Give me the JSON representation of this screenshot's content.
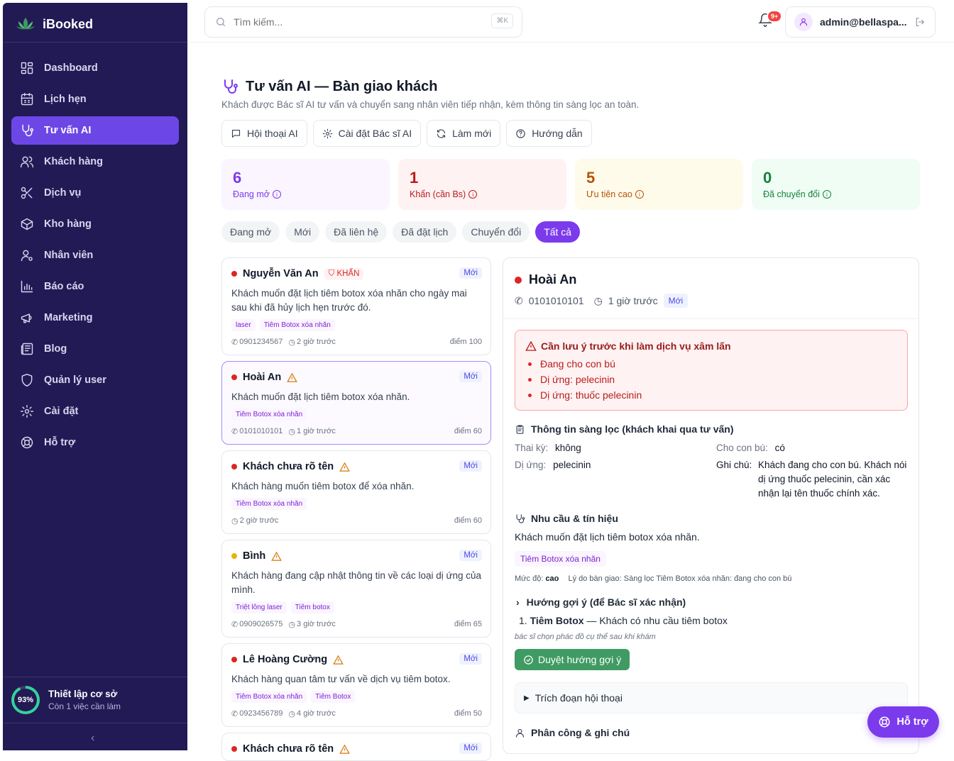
{
  "brand": {
    "name": "iBooked"
  },
  "nav": [
    {
      "label": "Dashboard",
      "icon": "grid-icon"
    },
    {
      "label": "Lịch hẹn",
      "icon": "calendar-icon"
    },
    {
      "label": "Tư vấn AI",
      "icon": "stethoscope-icon"
    },
    {
      "label": "Khách hàng",
      "icon": "users-icon"
    },
    {
      "label": "Dịch vụ",
      "icon": "scissors-icon"
    },
    {
      "label": "Kho hàng",
      "icon": "box-icon"
    },
    {
      "label": "Nhân viên",
      "icon": "user-gear-icon"
    },
    {
      "label": "Báo cáo",
      "icon": "bar-chart-icon"
    },
    {
      "label": "Marketing",
      "icon": "megaphone-icon"
    },
    {
      "label": "Blog",
      "icon": "newspaper-icon"
    },
    {
      "label": "Quản lý user",
      "icon": "shield-icon"
    },
    {
      "label": "Cài đặt",
      "icon": "gear-icon"
    },
    {
      "label": "Hỗ trợ",
      "icon": "lifebuoy-icon"
    }
  ],
  "setup": {
    "percent": "93%",
    "percent_value": 93,
    "title": "Thiết lập cơ sở",
    "subtitle": "Còn 1 việc cần làm"
  },
  "topbar": {
    "search_placeholder": "Tìm kiếm...",
    "shortcut": "⌘K",
    "notifications": "9+",
    "user_email": "admin@bellaspa..."
  },
  "page": {
    "title": "Tư vấn AI — Bàn giao khách",
    "subtitle": "Khách được Bác sĩ AI tư vấn và chuyển sang nhân viên tiếp nhận, kèm thông tin sàng lọc an toàn.",
    "actions": [
      "Hội thoại AI",
      "Cài đặt Bác sĩ AI",
      "Làm mới",
      "Hướng dẫn"
    ]
  },
  "stats": [
    {
      "value": "6",
      "label": "Đang mở",
      "color": "#7c3aed",
      "bg": "#faf5ff"
    },
    {
      "value": "1",
      "label": "Khẩn (cần Bs)",
      "color": "#b91c1c",
      "bg": "#fef2f2"
    },
    {
      "value": "5",
      "label": "Ưu tiên cao",
      "color": "#b45309",
      "bg": "#fffbeb"
    },
    {
      "value": "0",
      "label": "Đã chuyển đổi",
      "color": "#15803d",
      "bg": "#f0fdf4"
    }
  ],
  "filters": [
    "Đang mở",
    "Mới",
    "Đã liên hệ",
    "Đã đặt lịch",
    "Chuyển đổi",
    "Tất cả"
  ],
  "cards": [
    {
      "name": "Nguyễn Văn An",
      "urgent": "KHẨN",
      "status": "Mới",
      "desc": "Khách muốn đặt lịch tiêm botox xóa nhăn cho ngày mai sau khi đã hủy lịch hẹn trước đó.",
      "tags": [
        "laser",
        "Tiêm Botox xóa nhăn"
      ],
      "phone": "0901234567",
      "time": "2 giờ trước",
      "score": "điểm 100"
    },
    {
      "name": "Hoài An",
      "status": "Mới",
      "desc": "Khách muốn đặt lịch tiêm botox xóa nhăn.",
      "tags": [
        "Tiêm Botox xóa nhăn"
      ],
      "phone": "0101010101",
      "time": "1 giờ trước",
      "score": "điểm 60"
    },
    {
      "name": "Khách chưa rõ tên",
      "status": "Mới",
      "desc": "Khách hàng muốn tiêm botox để xóa nhăn.",
      "tags": [
        "Tiêm Botox xóa nhăn"
      ],
      "phone": "",
      "time": "2 giờ trước",
      "score": "điểm 60"
    },
    {
      "name": "Bình",
      "status": "Mới",
      "desc": "Khách hàng đang cập nhật thông tin về các loại dị ứng của mình.",
      "tags": [
        "Triệt lông laser",
        "Tiêm botox"
      ],
      "phone": "0909026575",
      "time": "3 giờ trước",
      "score": "điểm 65"
    },
    {
      "name": "Lê Hoàng Cường",
      "status": "Mới",
      "desc": "Khách hàng quan tâm tư vấn về dịch vụ tiêm botox.",
      "tags": [
        "Tiêm Botox xóa nhăn",
        "Tiêm Botox"
      ],
      "phone": "0923456789",
      "time": "4 giờ trước",
      "score": "điểm 50"
    },
    {
      "name": "Khách chưa rõ tên",
      "status": "Mới"
    }
  ],
  "detail": {
    "name": "Hoài An",
    "phone": "0101010101",
    "time": "1 giờ trước",
    "status": "Mới",
    "alert_title": "Cần lưu ý trước khi làm dịch vụ xâm lấn",
    "alert_items": [
      "Đang cho con bú",
      "Dị ứng: pelecinin",
      "Dị ứng: thuốc pelecinin"
    ],
    "screening_title": "Thông tin sàng lọc (khách khai qua tư vấn)",
    "pregnant_label": "Thai kỳ:",
    "pregnant_value": "không",
    "allergy_label": "Dị ứng:",
    "allergy_value": "pelecinin",
    "breastfeed_label": "Cho con bú:",
    "breastfeed_value": "có",
    "note_label": "Ghi chú:",
    "note_value": "Khách đang cho con bú. Khách nói dị ứng thuốc pelecinin, cần xác nhận lại tên thuốc chính xác.",
    "needs_title": "Nhu cầu & tín hiệu",
    "needs_text": "Khách muốn đặt lịch tiêm botox xóa nhăn.",
    "needs_tag": "Tiêm Botox xóa nhăn",
    "level_label": "Mức độ:",
    "level_value": "cao",
    "reason": "Lý do bàn giao: Sàng lọc Tiêm Botox xóa nhăn: đang cho con bú",
    "suggest_title": "Hướng gợi ý (để Bác sĩ xác nhận)",
    "suggest_item_name": "Tiêm Botox",
    "suggest_item_desc": "— Khách có nhu cầu tiêm botox",
    "suggest_note": "bác sĩ chọn phác đồ cụ thể sau khi khám",
    "approve_label": "Duyệt hướng gợi ý",
    "excerpt_label": "Trích đoạn hội thoại",
    "assign_title": "Phân công & ghi chú"
  },
  "help_button": "Hỗ trợ"
}
